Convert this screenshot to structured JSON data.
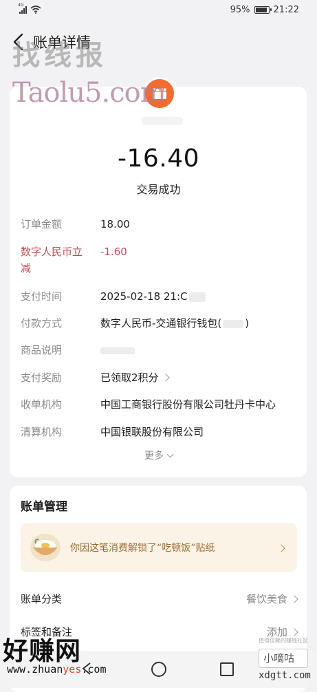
{
  "status_bar": {
    "network": "4G",
    "battery": "95%",
    "battery_level": 0.95,
    "time": "21:22"
  },
  "header": {
    "title": "账单详情"
  },
  "watermarks": {
    "top_cn": "找线报",
    "top_en": "Taolu5.com",
    "bottom_cn": "好赚网",
    "bottom_url_prefix": "www.zhuan",
    "bottom_url_highlight": "yes",
    "bottom_url_suffix": ".com",
    "bottom_right_top": "值得信赖的赚钱社区",
    "bottom_right": "小嘀咕",
    "bottom_right_url": "xdgtt.com"
  },
  "summary": {
    "amount": "-16.40",
    "status": "交易成功"
  },
  "details": [
    {
      "label": "订单金额",
      "value": "18.00"
    },
    {
      "label_line1": "数字人民币立",
      "label_line2": "减",
      "value": "-1.60"
    },
    {
      "label": "支付时间",
      "value": "2025-02-18 21:C"
    },
    {
      "label": "付款方式",
      "value": "数字人民币-交通银行钱包(",
      "value_end": ")"
    },
    {
      "label": "商品说明",
      "value": ""
    },
    {
      "label": "支付奖励",
      "value": "已领取2积分"
    },
    {
      "label": "收单机构",
      "value": "中国工商银行股份有限公司牡丹卡中心"
    },
    {
      "label": "清算机构",
      "value": "中国银联股份有限公司"
    }
  ],
  "more_label": "更多",
  "management": {
    "title": "账单管理",
    "banner_text": "你因这笔消费解锁了“吃顿饭”贴纸",
    "category_label": "账单分类",
    "category_value": "餐饮美食",
    "tags_label": "标签和备注",
    "tags_action": "添加"
  },
  "icons": {
    "back": "back-arrow-icon",
    "merchant": "shop-icon",
    "sticker": "rice-bowl-icon"
  },
  "colors": {
    "accent_orange": "#f26b2f",
    "discount_red": "#c9494f",
    "banner_bg": "#fbf4e6",
    "banner_text": "#a06c2e"
  }
}
